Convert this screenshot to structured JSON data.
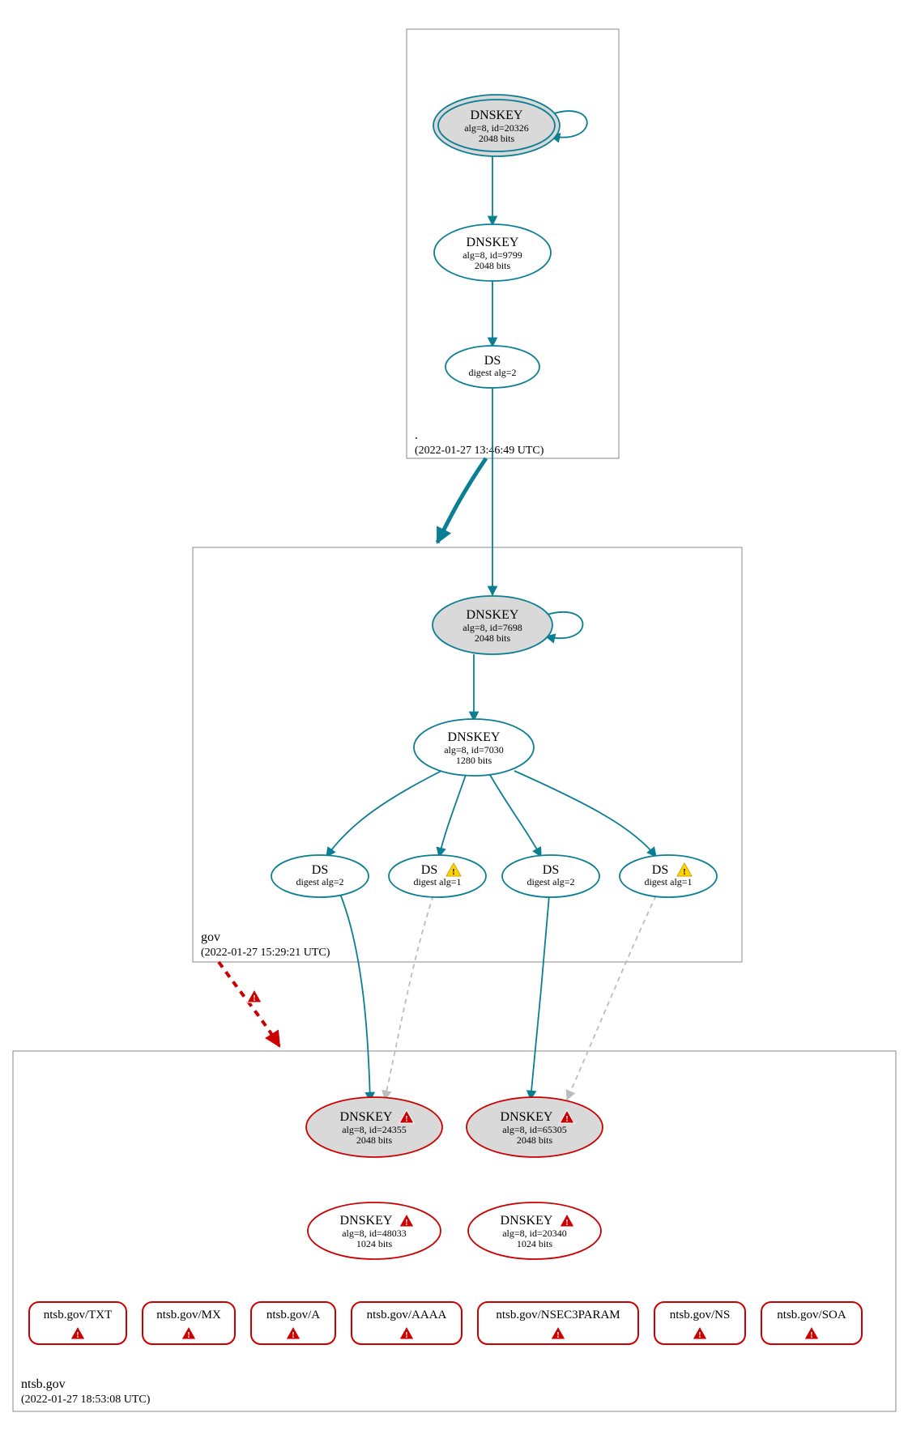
{
  "zones": {
    "root": {
      "label": ".",
      "timestamp": "(2022-01-27 13:46:49 UTC)"
    },
    "gov": {
      "label": "gov",
      "timestamp": "(2022-01-27 15:29:21 UTC)"
    },
    "ntsb": {
      "label": "ntsb.gov",
      "timestamp": "(2022-01-27 18:53:08 UTC)"
    }
  },
  "nodes": {
    "root_ksk": {
      "title": "DNSKEY",
      "l2": "alg=8, id=20326",
      "l3": "2048 bits"
    },
    "root_zsk": {
      "title": "DNSKEY",
      "l2": "alg=8, id=9799",
      "l3": "2048 bits"
    },
    "root_ds": {
      "title": "DS",
      "l2": "digest alg=2",
      "l3": ""
    },
    "gov_ksk": {
      "title": "DNSKEY",
      "l2": "alg=8, id=7698",
      "l3": "2048 bits"
    },
    "gov_zsk": {
      "title": "DNSKEY",
      "l2": "alg=8, id=7030",
      "l3": "1280 bits"
    },
    "gov_ds1": {
      "title": "DS",
      "l2": "digest alg=2",
      "l3": ""
    },
    "gov_ds2": {
      "title": "DS",
      "l2": "digest alg=1",
      "l3": "",
      "warn": "yellow"
    },
    "gov_ds3": {
      "title": "DS",
      "l2": "digest alg=2",
      "l3": ""
    },
    "gov_ds4": {
      "title": "DS",
      "l2": "digest alg=1",
      "l3": "",
      "warn": "yellow"
    },
    "ntsb_ksk1": {
      "title": "DNSKEY",
      "l2": "alg=8, id=24355",
      "l3": "2048 bits",
      "warn": "red"
    },
    "ntsb_ksk2": {
      "title": "DNSKEY",
      "l2": "alg=8, id=65305",
      "l3": "2048 bits",
      "warn": "red"
    },
    "ntsb_zsk1": {
      "title": "DNSKEY",
      "l2": "alg=8, id=48033",
      "l3": "1024 bits",
      "warn": "red"
    },
    "ntsb_zsk2": {
      "title": "DNSKEY",
      "l2": "alg=8, id=20340",
      "l3": "1024 bits",
      "warn": "red"
    }
  },
  "records": [
    {
      "label": "ntsb.gov/TXT"
    },
    {
      "label": "ntsb.gov/MX"
    },
    {
      "label": "ntsb.gov/A"
    },
    {
      "label": "ntsb.gov/AAAA"
    },
    {
      "label": "ntsb.gov/NSEC3PARAM"
    },
    {
      "label": "ntsb.gov/NS"
    },
    {
      "label": "ntsb.gov/SOA"
    }
  ],
  "icons": {
    "warn_yellow": "⚠",
    "warn_red": "⚠"
  },
  "colors": {
    "teal": "#0a7f93",
    "red": "#cc0000",
    "grayFill": "#d9d9d9",
    "grayEdge": "#bdbdbd",
    "zoneStroke": "#888888"
  }
}
